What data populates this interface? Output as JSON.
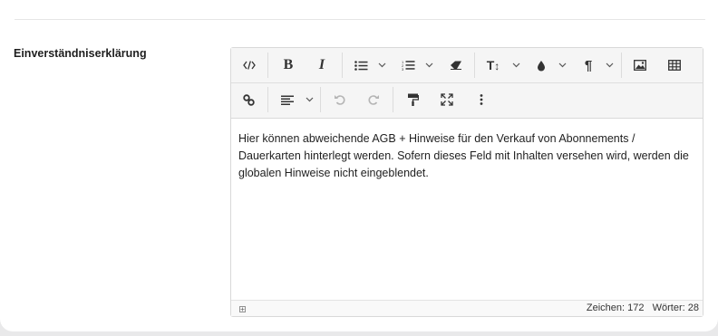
{
  "field": {
    "label": "Einverständniserklärung"
  },
  "editor": {
    "content": "Hier können abweichende AGB + Hinweise für den Verkauf von Abonnements / Dauerkarten hinterlegt werden. Sofern dieses Feld mit Inhalten versehen wird, werden die globalen Hinweise nicht eingeblendet.",
    "toolbar_row1": [
      "code-view-icon",
      "bold-icon",
      "italic-icon",
      "bulleted-list-icon",
      "numbered-list-icon",
      "eraser-icon",
      "text-size-icon",
      "text-color-icon",
      "paragraph-icon",
      "image-icon",
      "table-icon"
    ],
    "toolbar_row2": [
      "link-icon",
      "align-icon",
      "undo-icon",
      "redo-icon",
      "format-painter-icon",
      "fullscreen-icon",
      "more-icon"
    ],
    "text_size_label": "T",
    "status": {
      "chars": "Zeichen: 172",
      "words": "Wörter: 28"
    }
  }
}
